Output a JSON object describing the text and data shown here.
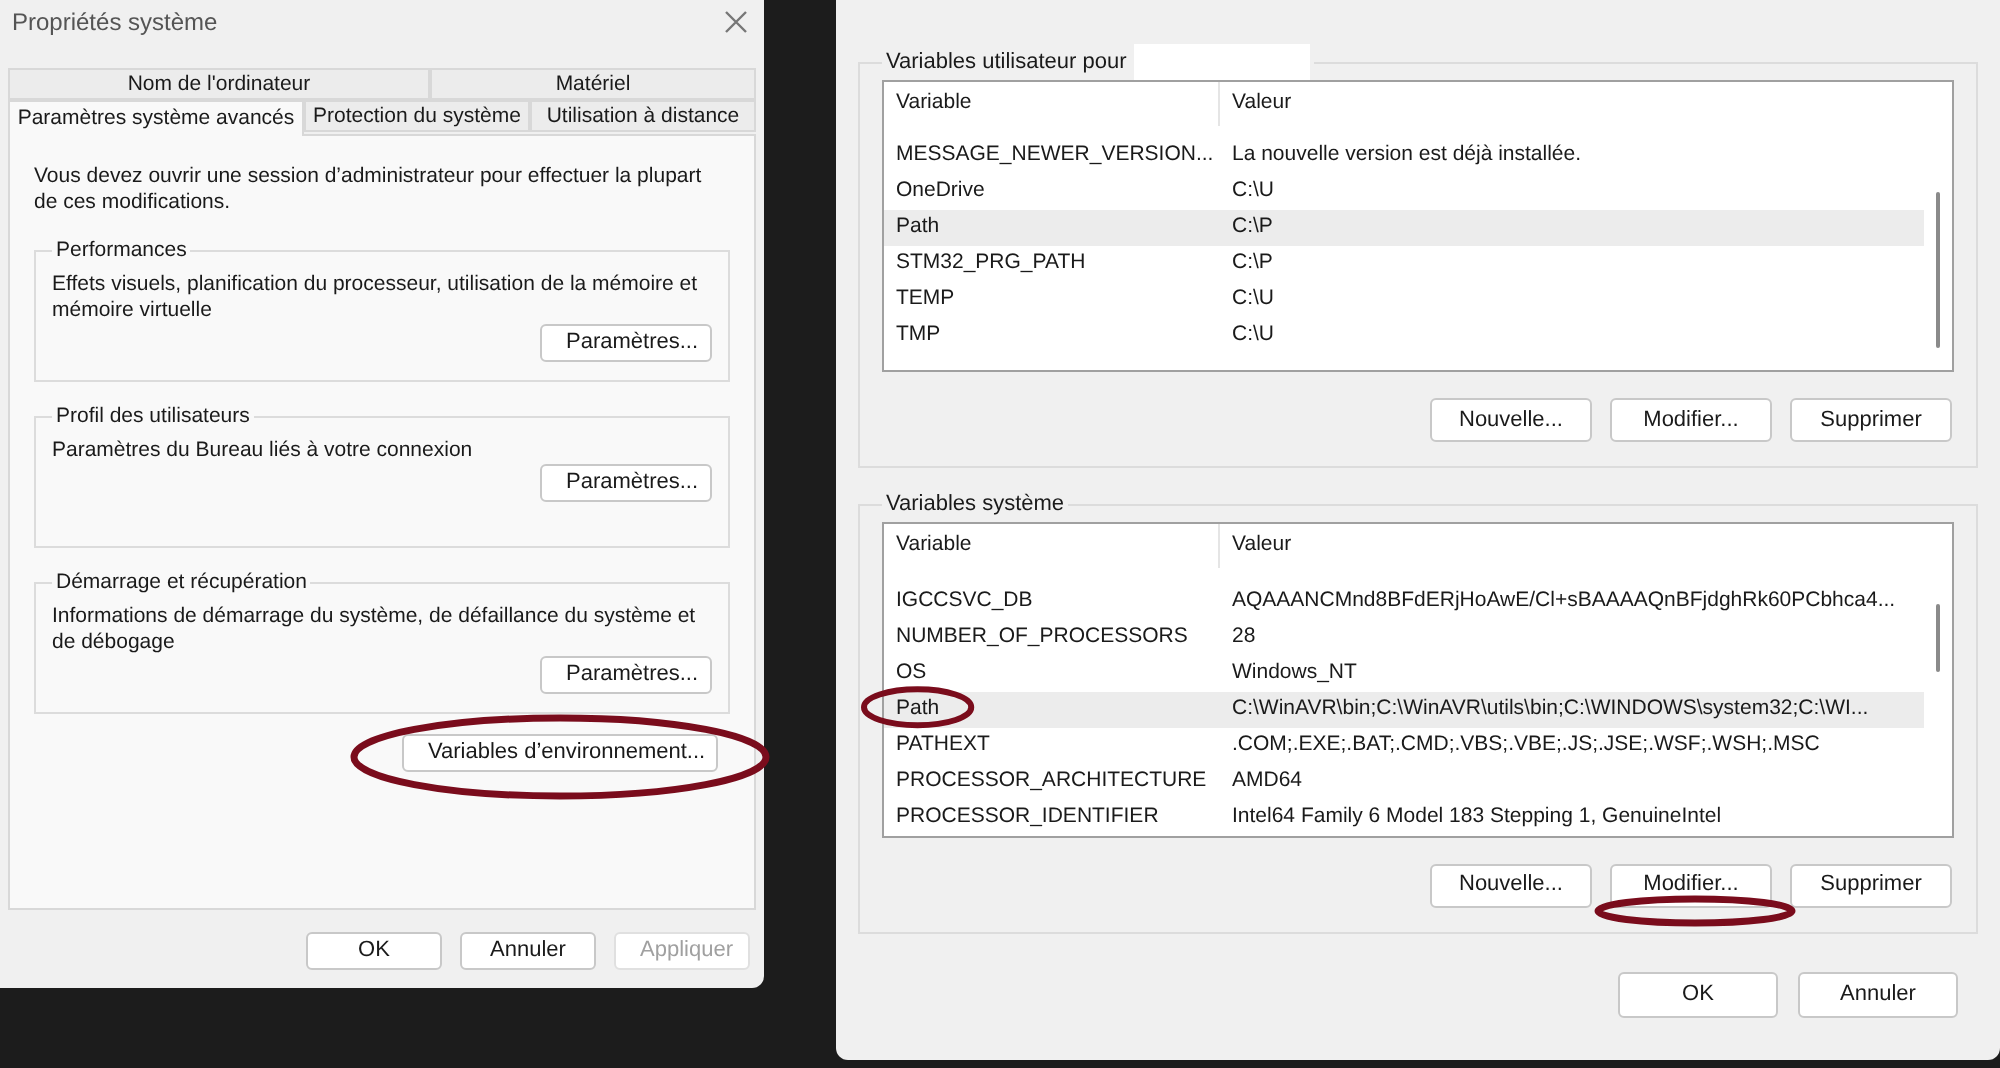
{
  "system_properties": {
    "title": "Propriétés système",
    "tab_rows": [
      [
        {
          "label": "Nom de l'ordinateur",
          "selected": false
        },
        {
          "label": "Matériel",
          "selected": false
        }
      ],
      [
        {
          "label": "Paramètres système avancés",
          "selected": true
        },
        {
          "label": "Protection du système",
          "selected": false
        },
        {
          "label": "Utilisation à distance",
          "selected": false
        }
      ]
    ],
    "notice": "Vous devez ouvrir une session d’administrateur pour effectuer la plupart de ces modifications.",
    "groups": [
      {
        "title": "Performances",
        "text": "Effets visuels, planification du processeur, utilisation de la mémoire et mémoire virtuelle",
        "button": "Paramètres..."
      },
      {
        "title": "Profil des utilisateurs",
        "text": "Paramètres du Bureau liés à votre connexion",
        "button": "Paramètres..."
      },
      {
        "title": "Démarrage et récupération",
        "text": "Informations de démarrage du système, de défaillance du système et de débogage",
        "button": "Paramètres..."
      }
    ],
    "env_button": "Variables d’environnement...",
    "buttons": [
      {
        "label": "OK",
        "disabled": false
      },
      {
        "label": "Annuler",
        "disabled": false
      },
      {
        "label": "Appliquer",
        "disabled": true
      }
    ]
  },
  "environment_variables": {
    "sections": [
      {
        "title": "Variables utilisateur pour",
        "columns": [
          "Variable",
          "Valeur"
        ],
        "rows": [
          {
            "variable": "MESSAGE_NEWER_VERSION...",
            "value": "La nouvelle version est déjà installée.",
            "selected": false
          },
          {
            "variable": "OneDrive",
            "value": "C:\\U",
            "selected": false
          },
          {
            "variable": "Path",
            "value": "C:\\P",
            "selected": true
          },
          {
            "variable": "STM32_PRG_PATH",
            "value": "C:\\P",
            "selected": false
          },
          {
            "variable": "TEMP",
            "value": "C:\\U",
            "selected": false
          },
          {
            "variable": "TMP",
            "value": "C:\\U",
            "selected": false
          }
        ],
        "buttons": [
          "Nouvelle...",
          "Modifier...",
          "Supprimer"
        ]
      },
      {
        "title": "Variables système",
        "columns": [
          "Variable",
          "Valeur"
        ],
        "rows": [
          {
            "variable": "IGCCSVC_DB",
            "value": "AQAAANCMnd8BFdERjHoAwE/Cl+sBAAAAQnBFjdghRk60PCbhca4...",
            "selected": false
          },
          {
            "variable": "NUMBER_OF_PROCESSORS",
            "value": "28",
            "selected": false
          },
          {
            "variable": "OS",
            "value": "Windows_NT",
            "selected": false
          },
          {
            "variable": "Path",
            "value": "C:\\WinAVR\\bin;C:\\WinAVR\\utils\\bin;C:\\WINDOWS\\system32;C:\\WI...",
            "selected": true
          },
          {
            "variable": "PATHEXT",
            "value": ".COM;.EXE;.BAT;.CMD;.VBS;.VBE;.JS;.JSE;.WSF;.WSH;.MSC",
            "selected": false
          },
          {
            "variable": "PROCESSOR_ARCHITECTURE",
            "value": "AMD64",
            "selected": false
          },
          {
            "variable": "PROCESSOR_IDENTIFIER",
            "value": "Intel64 Family 6 Model 183 Stepping 1, GenuineIntel",
            "selected": false
          }
        ],
        "buttons": [
          "Nouvelle...",
          "Modifier...",
          "Supprimer"
        ]
      }
    ],
    "buttons": [
      "OK",
      "Annuler"
    ]
  }
}
